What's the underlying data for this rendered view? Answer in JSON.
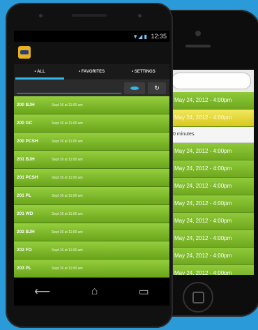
{
  "iphone": {
    "rows": [
      {
        "text": "May 24, 2012 - 4:00pm",
        "selected": false
      },
      {
        "text": "May 24, 2012 - 4:00pm",
        "selected": true
      }
    ],
    "note": "0 minutes.",
    "rows_after": [
      "May 24, 2012 - 4:00pm",
      "May 24, 2012 - 4:00pm",
      "May 24, 2012 - 4:00pm",
      "May 24, 2012 - 4:00pm",
      "May 24, 2012 - 4:00pm",
      "May 24, 2012 - 4:00pm",
      "May 24, 2012 - 4:00pm",
      "May 24, 2012 - 4:00pm",
      "May 24, 2012 - 4:00pm"
    ]
  },
  "android": {
    "status_time": "12:35",
    "tabs": [
      {
        "label": "ALL",
        "active": true
      },
      {
        "label": "FAVORITES",
        "active": false
      },
      {
        "label": "SETTINGS",
        "active": false
      }
    ],
    "rows": [
      {
        "code": "200 BJH",
        "time": "Sept 16 at 11:00 am"
      },
      {
        "code": "200 GC",
        "time": "Sept 16 at 11:00 am"
      },
      {
        "code": "200 PCSH",
        "time": "Sept 16 at 11:00 am"
      },
      {
        "code": "201 BJH",
        "time": "Sept 16 at 11:00 am"
      },
      {
        "code": "201 PCSH",
        "time": "Sept 16 at 11:00 am"
      },
      {
        "code": "201 PL",
        "time": "Sept 16 at 11:00 am"
      },
      {
        "code": "201 WD",
        "time": "Sept 16 at 11:00 am"
      },
      {
        "code": "202 BJH",
        "time": "Sept 16 at 11:00 am"
      },
      {
        "code": "202 FO",
        "time": "Sept 16 at 11:00 am"
      },
      {
        "code": "203 PL",
        "time": "Sept 16 at 11:00 am"
      }
    ]
  }
}
